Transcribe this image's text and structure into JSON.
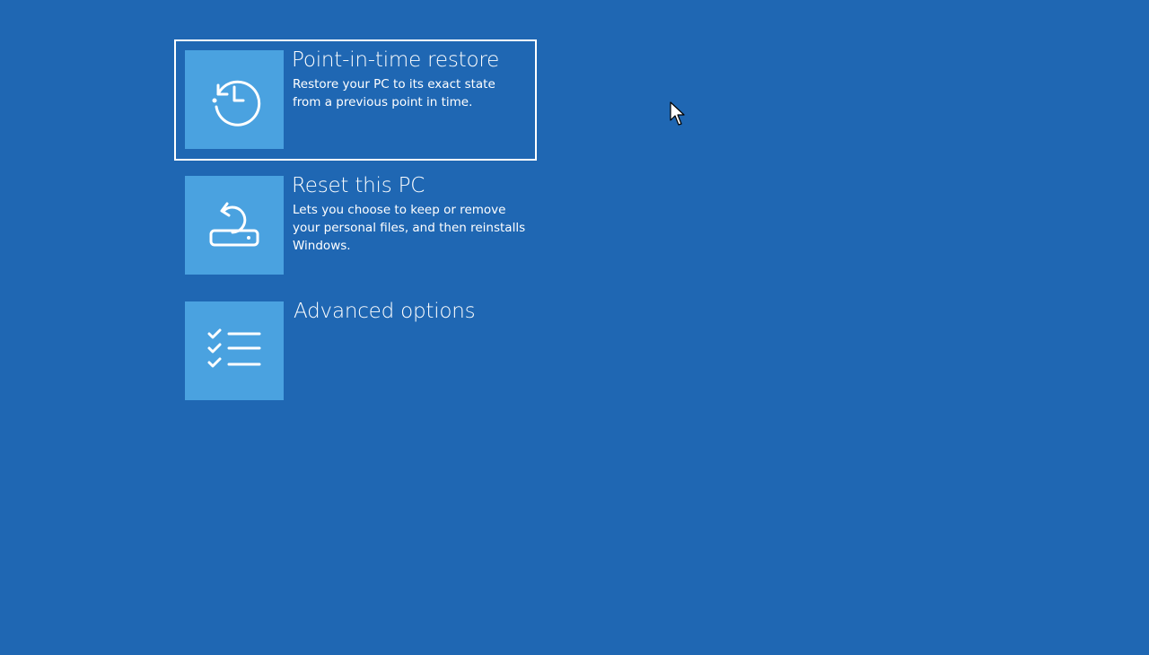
{
  "options": [
    {
      "title": "Point-in-time restore",
      "description": "Restore your PC to its exact state from a previous point in time.",
      "icon": "history-restore-icon",
      "selected": true
    },
    {
      "title": "Reset this PC",
      "description": "Lets you choose to keep or remove your personal files, and then reinstalls Windows.",
      "icon": "reset-pc-icon",
      "selected": false
    },
    {
      "title": "Advanced options",
      "description": "",
      "icon": "checklist-icon",
      "selected": false
    }
  ],
  "colors": {
    "background": "#1f67b3",
    "tile": "#4aa2e0",
    "text": "#ffffff"
  }
}
